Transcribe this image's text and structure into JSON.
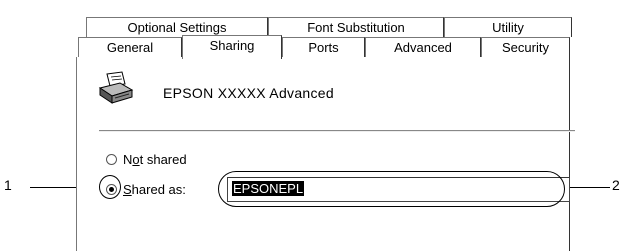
{
  "tabs": {
    "row1": [
      "Optional Settings",
      "Font Substitution",
      "Utility"
    ],
    "row2": [
      "General",
      "Sharing",
      "Ports",
      "Advanced",
      "Security"
    ],
    "selected": "Sharing"
  },
  "printer": {
    "name": "EPSON  XXXXX  Advanced",
    "icon": "printer-icon"
  },
  "sharing": {
    "not_shared_label": "Not shared",
    "shared_as_label": "Shared as:",
    "shared_as_value": "EPSONEPL",
    "selected": "shared"
  },
  "callouts": {
    "left": "1",
    "right": "2"
  }
}
